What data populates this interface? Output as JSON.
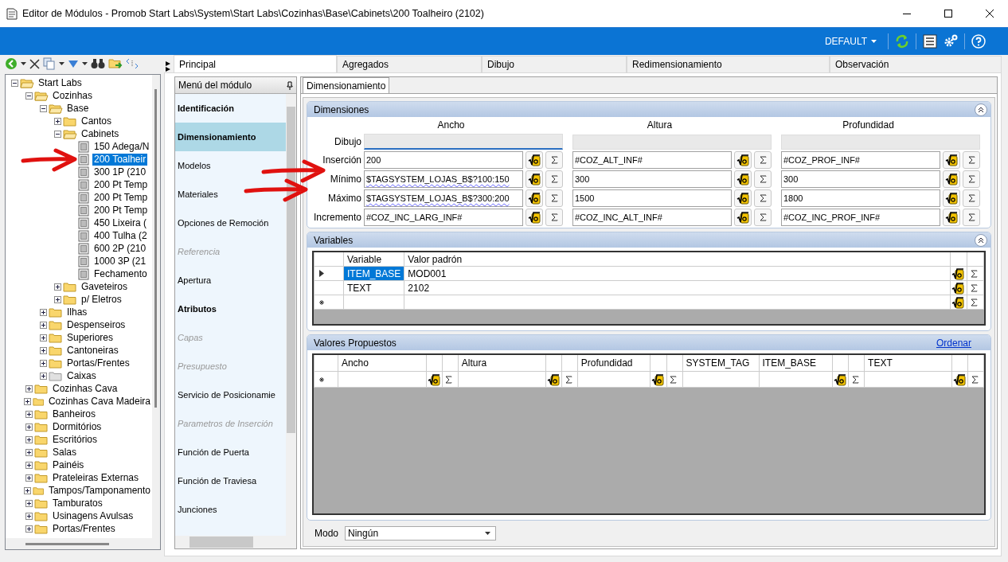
{
  "window": {
    "title": "Editor de Módulos - Promob Start Labs\\System\\Start Labs\\Cozinhas\\Base\\Cabinets\\200 Toalheiro (2102)"
  },
  "ribbon": {
    "profile": "DEFAULT"
  },
  "tree": [
    {
      "label": "Start Labs",
      "kind": "folder",
      "expanded": true,
      "selected": false,
      "children": [
        {
          "label": "Cozinhas",
          "kind": "folder",
          "expanded": true,
          "selected": false,
          "children": [
            {
              "label": "Base",
              "kind": "folder",
              "expanded": true,
              "selected": false,
              "children": [
                {
                  "label": "Cantos",
                  "kind": "folder",
                  "expanded": false,
                  "selected": false
                },
                {
                  "label": "Cabinets",
                  "kind": "folder",
                  "expanded": true,
                  "selected": false,
                  "children": [
                    {
                      "label": "150 Adega/N",
                      "kind": "module",
                      "selected": false
                    },
                    {
                      "label": "200 Toalheir",
                      "kind": "module",
                      "selected": true
                    },
                    {
                      "label": "300 1P (210",
                      "kind": "module",
                      "selected": false
                    },
                    {
                      "label": "200 Pt Temp",
                      "kind": "module",
                      "selected": false
                    },
                    {
                      "label": "200 Pt Temp",
                      "kind": "module",
                      "selected": false
                    },
                    {
                      "label": "200 Pt Temp",
                      "kind": "module",
                      "selected": false
                    },
                    {
                      "label": "450 Lixeira (",
                      "kind": "module",
                      "selected": false
                    },
                    {
                      "label": "400 Tulha (2",
                      "kind": "module",
                      "selected": false
                    },
                    {
                      "label": "600 2P (210",
                      "kind": "module",
                      "selected": false
                    },
                    {
                      "label": "1000 3P (21",
                      "kind": "module",
                      "selected": false
                    },
                    {
                      "label": "Fechamento",
                      "kind": "module",
                      "selected": false
                    }
                  ]
                },
                {
                  "label": "Gaveteiros",
                  "kind": "folder",
                  "expanded": false,
                  "selected": false
                },
                {
                  "label": "p/ Eletros",
                  "kind": "folder",
                  "expanded": false,
                  "selected": false
                }
              ]
            },
            {
              "label": "Ilhas",
              "kind": "folder",
              "expanded": false,
              "selected": false
            },
            {
              "label": "Despenseiros",
              "kind": "folder",
              "expanded": false,
              "selected": false
            },
            {
              "label": "Superiores",
              "kind": "folder",
              "expanded": false,
              "selected": false
            },
            {
              "label": "Cantoneiras",
              "kind": "folder",
              "expanded": false,
              "selected": false
            },
            {
              "label": "Portas/Frentes",
              "kind": "folder",
              "expanded": false,
              "selected": false
            },
            {
              "label": "Caixas",
              "kind": "empty-folder",
              "expanded": false,
              "selected": false
            }
          ]
        },
        {
          "label": "Cozinhas Cava",
          "kind": "folder",
          "expanded": false,
          "selected": false
        },
        {
          "label": "Cozinhas Cava Madeira",
          "kind": "folder",
          "expanded": false,
          "selected": false
        },
        {
          "label": "Banheiros",
          "kind": "folder",
          "expanded": false,
          "selected": false
        },
        {
          "label": "Dormitórios",
          "kind": "folder",
          "expanded": false,
          "selected": false
        },
        {
          "label": "Escritórios",
          "kind": "folder",
          "expanded": false,
          "selected": false
        },
        {
          "label": "Salas",
          "kind": "folder",
          "expanded": false,
          "selected": false
        },
        {
          "label": "Painéis",
          "kind": "folder",
          "expanded": false,
          "selected": false
        },
        {
          "label": "Prateleiras Externas",
          "kind": "folder",
          "expanded": false,
          "selected": false
        },
        {
          "label": "Tampos/Tamponamento",
          "kind": "folder",
          "expanded": false,
          "selected": false
        },
        {
          "label": "Tamburatos",
          "kind": "folder",
          "expanded": false,
          "selected": false
        },
        {
          "label": "Usinagens Avulsas",
          "kind": "folder",
          "expanded": false,
          "selected": false
        },
        {
          "label": "Portas/Frentes",
          "kind": "folder",
          "expanded": false,
          "selected": false
        }
      ]
    }
  ],
  "tabs": [
    {
      "label": "Principal",
      "selected": true
    },
    {
      "label": "Agregados",
      "selected": false
    },
    {
      "label": "Dibujo",
      "selected": false
    },
    {
      "label": "Redimensionamiento",
      "selected": false
    },
    {
      "label": "Observación",
      "selected": false
    }
  ],
  "module_menu": {
    "title": "Menú del módulo",
    "items": [
      {
        "label": "Identificación",
        "bold": true,
        "disabled": false,
        "selected": false
      },
      {
        "label": "Dimensionamiento",
        "bold": true,
        "disabled": false,
        "selected": true
      },
      {
        "label": "Modelos",
        "bold": false,
        "disabled": false,
        "selected": false
      },
      {
        "label": "Materiales",
        "bold": false,
        "disabled": false,
        "selected": false
      },
      {
        "label": "Opciones de Remoción",
        "bold": false,
        "disabled": false,
        "selected": false
      },
      {
        "label": "Referencia",
        "bold": false,
        "disabled": true,
        "selected": false
      },
      {
        "label": "Apertura",
        "bold": false,
        "disabled": false,
        "selected": false
      },
      {
        "label": "Atributos",
        "bold": true,
        "disabled": false,
        "selected": false
      },
      {
        "label": "Capas",
        "bold": false,
        "disabled": true,
        "selected": false
      },
      {
        "label": "Presupuesto",
        "bold": false,
        "disabled": true,
        "selected": false
      },
      {
        "label": "Servicio de Posicionamie",
        "bold": false,
        "disabled": false,
        "selected": false
      },
      {
        "label": "Parametros de Inserción",
        "bold": false,
        "disabled": true,
        "selected": false
      },
      {
        "label": "Función de Puerta",
        "bold": false,
        "disabled": false,
        "selected": false
      },
      {
        "label": "Función de Traviesa",
        "bold": false,
        "disabled": false,
        "selected": false
      },
      {
        "label": "Junciones",
        "bold": false,
        "disabled": false,
        "selected": false
      }
    ]
  },
  "subtab": {
    "label": "Dimensionamiento",
    "selected": true
  },
  "dimensions": {
    "title": "Dimensiones",
    "columns": [
      "Ancho",
      "Altura",
      "Profundidad"
    ],
    "rows": [
      {
        "label": "Dibujo",
        "kind": "drawing",
        "cells": [
          {
            "focused": true
          },
          {
            "focused": false
          },
          {
            "focused": false
          }
        ]
      },
      {
        "label": "Inserción",
        "kind": "value",
        "cells": [
          {
            "value": "200",
            "flagged": false
          },
          {
            "value": "#COZ_ALT_INF#",
            "flagged": false
          },
          {
            "value": "#COZ_PROF_INF#",
            "flagged": false
          }
        ]
      },
      {
        "label": "Mínimo",
        "kind": "value",
        "cells": [
          {
            "value": "$TAGSYSTEM_LOJAS_B$?100:150",
            "flagged": true
          },
          {
            "value": "300",
            "flagged": false
          },
          {
            "value": "300",
            "flagged": false
          }
        ]
      },
      {
        "label": "Máximo",
        "kind": "value",
        "cells": [
          {
            "value": "$TAGSYSTEM_LOJAS_B$?300:200",
            "flagged": true
          },
          {
            "value": "1500",
            "flagged": false
          },
          {
            "value": "1800",
            "flagged": false
          }
        ]
      },
      {
        "label": "Incremento",
        "kind": "value",
        "cells": [
          {
            "value": "#COZ_INC_LARG_INF#",
            "flagged": false
          },
          {
            "value": "#COZ_INC_ALT_INF#",
            "flagged": false
          },
          {
            "value": "#COZ_INC_PROF_INF#",
            "flagged": false
          }
        ]
      }
    ]
  },
  "variables": {
    "title": "Variables",
    "columns": [
      "Variable",
      "Valor padrón"
    ],
    "rows": [
      {
        "current": true,
        "new": false,
        "cells": [
          {
            "value": "ITEM_BASE",
            "selected": true
          },
          {
            "value": "MOD001",
            "selected": false
          }
        ]
      },
      {
        "current": false,
        "new": false,
        "cells": [
          {
            "value": "TEXT",
            "selected": false
          },
          {
            "value": "2102",
            "selected": false
          }
        ]
      },
      {
        "current": false,
        "new": true,
        "cells": [
          {
            "selected": false
          },
          {
            "selected": false
          }
        ]
      }
    ]
  },
  "proposed_values": {
    "title": "Valores Propuestos",
    "link": "Ordenar",
    "columns": [
      {
        "label": "Ancho",
        "formula": true
      },
      {
        "label": "Altura",
        "formula": true
      },
      {
        "label": "Profundidad",
        "formula": true
      },
      {
        "label": "SYSTEM_TAG",
        "formula": false
      },
      {
        "label": "ITEM_BASE",
        "formula": true
      },
      {
        "label": "TEXT",
        "formula": true
      }
    ]
  },
  "mode": {
    "label": "Modo",
    "value": "Ningún"
  },
  "annotations": [
    {
      "kind": "arrow"
    },
    {
      "kind": "arrow"
    },
    {
      "kind": "arrow"
    }
  ]
}
